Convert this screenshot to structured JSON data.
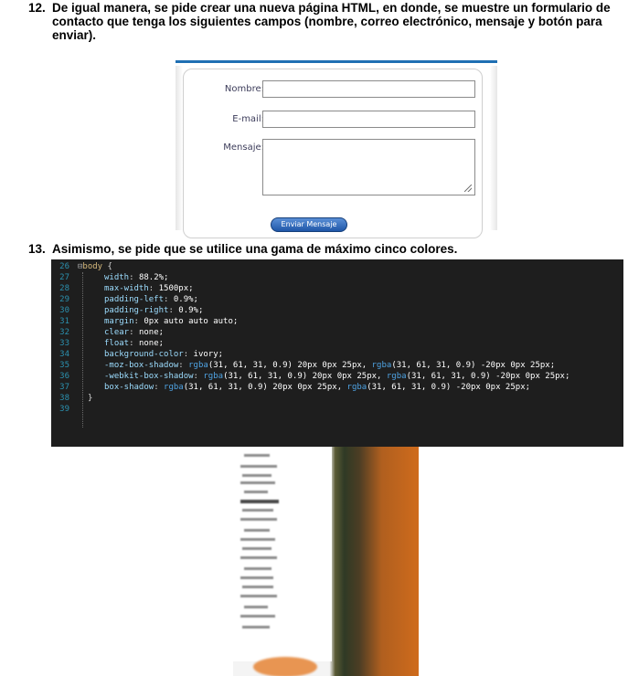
{
  "question12": {
    "number": "12.",
    "text": "De igual manera, se pide crear una nueva página HTML, en donde, se muestre un formulario de contacto que tenga los siguientes campos (nombre, correo electrónico, mensaje y botón para enviar)."
  },
  "form": {
    "name_label": "Nombre:",
    "email_label": "E-mail:",
    "message_label": "Mensaje:",
    "submit_label": "Enviar Mensaje",
    "accent_color": "#1f6fb3"
  },
  "question13": {
    "number": "13.",
    "text": "Asimismo, se pide que se utilice una gama de máximo cinco colores."
  },
  "code": {
    "background": "#1e1e1e",
    "lines": [
      {
        "n": "26",
        "fold": "⊟",
        "sel": "body",
        "brace": " {"
      },
      {
        "n": "27",
        "prop": "width",
        "val": "88.2%;"
      },
      {
        "n": "28",
        "prop": "max-width",
        "val": "1500px;"
      },
      {
        "n": "29",
        "prop": "padding-left",
        "val": "0.9%;"
      },
      {
        "n": "30",
        "prop": "padding-right",
        "val": "0.9%;"
      },
      {
        "n": "31",
        "prop": "margin",
        "val": "0px auto auto auto;"
      },
      {
        "n": "32",
        "prop": "clear",
        "val": "none;"
      },
      {
        "n": "33",
        "prop": "float",
        "val": "none;"
      },
      {
        "n": "34",
        "prop": "background-color",
        "val": "ivory;"
      },
      {
        "n": "35",
        "prop": "-moz-box-shadow",
        "fn1": "rgba",
        "a1": "(31, 61, 31, 0.9) 20px 0px 25px,  ",
        "fn2": "rgba",
        "a2": "(31, 61, 31, 0.9) -20px 0px 25px;"
      },
      {
        "n": "36",
        "prop": "-webkit-box-shadow",
        "fn1": "rgba",
        "a1": "(31, 61, 31, 0.9) 20px 0px 25px,  ",
        "fn2": "rgba",
        "a2": "(31, 61, 31, 0.9) -20px 0px 25px;"
      },
      {
        "n": "37",
        "prop": "box-shadow",
        "fn1": "rgba",
        "a1": "(31, 61, 31, 0.9) 20px 0px 25px,  ",
        "fn2": "rgba",
        "a2": "(31, 61, 31, 0.9) -20px 0px 25px;"
      },
      {
        "n": "38",
        "close": "}"
      },
      {
        "n": "39"
      }
    ]
  }
}
